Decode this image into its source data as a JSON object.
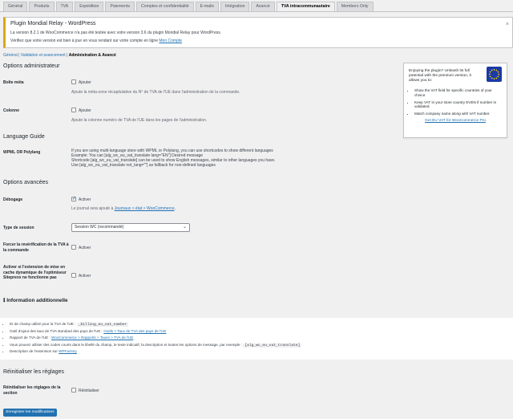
{
  "tabs": [
    "Général",
    "Produits",
    "TVA",
    "Expédition",
    "Paiements",
    "Comptes et confidentialité",
    "E-mails",
    "Intégration",
    "Avancé",
    "TVA intracommunautaire",
    "Members Only"
  ],
  "active_tab_index": 9,
  "notice": {
    "title": "Plugin Mondial Relay - WordPress",
    "line1": "La version 8.2.1 de WooCommerce n'a pas été testée avec votre version 3.6 du plugin Mondial Relay pour WordPress.",
    "line2_pre": "Vérifiez que votre version est bien à jour en vous rendant sur votre compte en ligne ",
    "line2_link": "Mon Compte",
    "close": "×"
  },
  "subnav": {
    "link1": "Général",
    "sep1": " | ",
    "link2": "Validation et avancement",
    "sep2": " | ",
    "current": "Administration & Avancé"
  },
  "sections": {
    "admin_title": "Options administrateur",
    "language_title": "Language Guide",
    "advanced_title": "Options avancées",
    "info_title": "Information additionnelle",
    "reset_title": "Réinitialiser les réglages"
  },
  "fields": {
    "boite_meta": {
      "label": "Boîte méta",
      "option": "Ajouter",
      "desc": "Ajoute la méta-zone récapitulative du N° de TVA de l'UE dans l'administration de la commande.",
      "checked": false
    },
    "colonne": {
      "label": "Colonne",
      "option": "Ajouter",
      "desc": "Ajoute la colonne numéro de TVA de l'UE dans les pages de l'administration.",
      "checked": false
    },
    "wpml": {
      "label": "WPML OR Polylang",
      "lines": [
        "If you are using multi-language store with WPML or Polylang, you can use shortcodes to show different languages",
        "Example: You can [alg_wc_eu_vat_translate lang=\"EN\"] Desired message",
        "Shortcode [alg_wc_eu_vat_translate] can be used to show English messages, similar to other languages you have.",
        "Use [alg_wc_eu_vat_translate not_lang=\"\"] as fallback for non-defined languages"
      ]
    },
    "debogage": {
      "label": "Débogage",
      "option": "Activer",
      "checked": true,
      "desc_pre": "Le journal sera ajouté à ",
      "desc_link": "Journaux > état > WooCommerce",
      "desc_post": "."
    },
    "session": {
      "label": "Type de session",
      "value": "Session WC (recommandé)"
    },
    "forcer": {
      "label": "Forcer la revérification de la TVA à la commande",
      "option": "Activer",
      "checked": false
    },
    "cache": {
      "label": "Activer si l'extension de mise en cache dynamique de l'optimiseur Siteprexx ne fonctionne pas",
      "option": "Activer",
      "checked": false
    },
    "reset": {
      "label": "Réinitialiser les réglages de la section",
      "option": "Réinitialiser",
      "checked": false
    }
  },
  "info": {
    "i1_pre": "ID de champ utilisé pour la TVA de l'UE : ",
    "i1_code": "_billing_eu_vat_number",
    "i2_pre": "Outil d'ajout des taux de TVA standard des pays de l'UE : ",
    "i2_link": "Outils > Taux de TVA des pays de l'UE",
    "i3_pre": "Rapport de TVA de l'UE : ",
    "i3_link": "WooCommerce > Rapports > Taxes > TVA de l'UE",
    "i4_pre": "Vous pouvez utiliser des codes courts dans le libellé du champ, le texte indicatif, la description et toutes les options de message, par exemple : ",
    "i4_code": "[alg_wc_eu_vat_translate]",
    "i5_pre": "Description de l'extension sur ",
    "i5_link": "WPFactory"
  },
  "sidebar": {
    "intro": "Enjoying the plugin? Unleash its full potential with the premium version, it allows you to:",
    "items": [
      "Show the VAT field for specific countries of your choice.",
      "Keep VAT in your store country EVEN if number is validated.",
      "Match company name along with VAT number."
    ],
    "cta": "Get EU VAT for WooCommerce Pro"
  },
  "save_button": "Enregistrer les modifications"
}
